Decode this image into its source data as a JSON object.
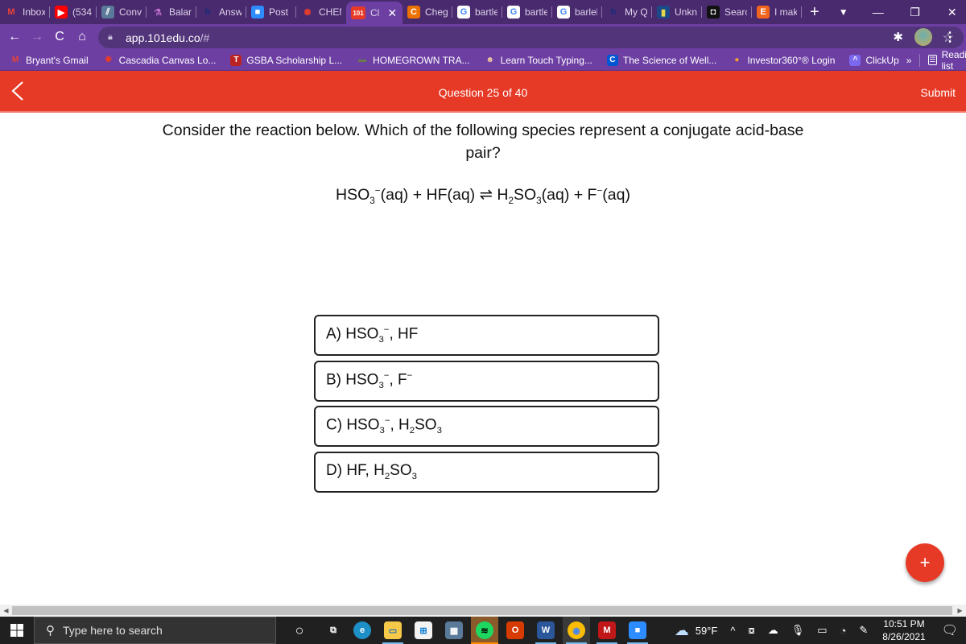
{
  "browser": {
    "tabs": [
      {
        "label": "Inbox",
        "icon": "gmail-icon",
        "glyph": "M",
        "color": "#ea4335",
        "bg": "transparent"
      },
      {
        "label": "(534)",
        "icon": "youtube-icon",
        "glyph": "▶",
        "color": "#fff",
        "bg": "#ff0000"
      },
      {
        "label": "Conv",
        "icon": "convert-icon",
        "glyph": "⫽",
        "color": "#fff",
        "bg": "#5a7a9a"
      },
      {
        "label": "Balan",
        "icon": "flask-icon",
        "glyph": "⚗",
        "color": "#c070d0",
        "bg": "transparent"
      },
      {
        "label": "Answ",
        "icon": "bartleby-icon",
        "glyph": "b",
        "color": "#1a2a7a",
        "bg": "transparent"
      },
      {
        "label": "Post",
        "icon": "zoom-icon",
        "glyph": "■",
        "color": "#fff",
        "bg": "#2d8cff"
      },
      {
        "label": "CHEM",
        "icon": "canvas-icon",
        "glyph": "✺",
        "color": "#e13d2d",
        "bg": "transparent"
      },
      {
        "label": "Cl",
        "icon": "101edu-icon",
        "glyph": "101",
        "color": "#fff",
        "bg": "#e63a26",
        "active": true
      },
      {
        "label": "Cheg",
        "icon": "chegg-icon",
        "glyph": "C",
        "color": "#fff",
        "bg": "#eb7100"
      },
      {
        "label": "bartle",
        "icon": "google-icon",
        "glyph": "G",
        "color": "#4285f4",
        "bg": "#fff"
      },
      {
        "label": "bartle",
        "icon": "google-icon",
        "glyph": "G",
        "color": "#4285f4",
        "bg": "#fff"
      },
      {
        "label": "barlel",
        "icon": "google-icon",
        "glyph": "G",
        "color": "#4285f4",
        "bg": "#fff"
      },
      {
        "label": "My Q",
        "icon": "bartleby-icon",
        "glyph": "b",
        "color": "#1a2a7a",
        "bg": "transparent"
      },
      {
        "label": "Unkn",
        "icon": "unknown-site-icon",
        "glyph": "▮",
        "color": "#e6d84a",
        "bg": "#1a4a8a"
      },
      {
        "label": "Searc",
        "icon": "search-site-icon",
        "glyph": "◘",
        "color": "#fff",
        "bg": "#111"
      },
      {
        "label": "I mak",
        "icon": "etsy-icon",
        "glyph": "E",
        "color": "#fff",
        "bg": "#f1641e"
      }
    ],
    "new_tab": "+",
    "window_controls": {
      "profile": "▼",
      "minimize": "—",
      "restore": "❐",
      "close": "✕"
    },
    "nav": {
      "back": "←",
      "forward": "→",
      "reload": "C",
      "home": "⌂"
    },
    "url_host": "app.101edu.co",
    "url_rest": "/#",
    "bookmarks": [
      {
        "label": "Bryant's Gmail",
        "icon": "gmail-icon",
        "glyph": "M",
        "color": "#ea4335",
        "bg": "transparent"
      },
      {
        "label": "Cascadia Canvas Lo...",
        "icon": "canvas-icon",
        "glyph": "✺",
        "color": "#e13d2d",
        "bg": "transparent"
      },
      {
        "label": "GSBA Scholarship L...",
        "icon": "gsba-icon",
        "glyph": "T",
        "color": "#fff",
        "bg": "#b22"
      },
      {
        "label": "HOMEGROWN TRA...",
        "icon": "homegrown-icon",
        "glyph": "▬",
        "color": "#6a7a4a",
        "bg": "transparent"
      },
      {
        "label": "Learn Touch Typing...",
        "icon": "typing-icon",
        "glyph": "☻",
        "color": "#f0c8a0",
        "bg": "transparent"
      },
      {
        "label": "The Science of Well...",
        "icon": "coursera-icon",
        "glyph": "C",
        "color": "#fff",
        "bg": "#0056d2"
      },
      {
        "label": "Investor360°® Login",
        "icon": "investor360-icon",
        "glyph": "●",
        "color": "#f0a030",
        "bg": "transparent"
      },
      {
        "label": "ClickUp",
        "icon": "clickup-icon",
        "glyph": "^",
        "color": "#fff",
        "bg": "#7b68ee"
      }
    ],
    "bookmarks_overflow": "»",
    "reading_list": "Reading list"
  },
  "app": {
    "header": {
      "question_counter": "Question 25 of 40",
      "submit_label": "Submit"
    },
    "question": {
      "text": "Consider the reaction below. Which of the following species represent a conjugate acid-base pair?",
      "equation_html": "HSO<sub>3</sub><sup>−</sup>(aq) + HF(aq) ⇌ H<sub>2</sub>SO<sub>3</sub>(aq) + F<sup>−</sup>(aq)"
    },
    "options": [
      {
        "letter": "A",
        "html": "A) HSO<sub>3</sub><sup>−</sup>, HF"
      },
      {
        "letter": "B",
        "html": "B) HSO<sub>3</sub><sup>−</sup>, F<sup>−</sup>"
      },
      {
        "letter": "C",
        "html": "C) HSO<sub>3</sub><sup>−</sup>, H<sub>2</sub>SO<sub>3</sub>"
      },
      {
        "letter": "D",
        "html": "D) HF, H<sub>2</sub>SO<sub>3</sub>"
      }
    ],
    "fab_label": "+"
  },
  "taskbar": {
    "search_placeholder": "Type here to search",
    "apps": [
      {
        "name": "cortana-icon",
        "glyph": "○",
        "color": "#fff",
        "bg": "transparent"
      },
      {
        "name": "task-view-icon",
        "glyph": "⧉",
        "color": "#fff",
        "bg": "transparent"
      },
      {
        "name": "edge-icon",
        "glyph": "e",
        "color": "#fff",
        "bg": "#1e90c8",
        "run": false
      },
      {
        "name": "file-explorer-icon",
        "glyph": "▭",
        "color": "#1e6fb8",
        "bg": "#f7c948",
        "run": true
      },
      {
        "name": "store-icon",
        "glyph": "⊞",
        "color": "#0078d4",
        "bg": "#f2f2f2",
        "run": false
      },
      {
        "name": "calculator-icon",
        "glyph": "▦",
        "color": "#fff",
        "bg": "#5a7a9a",
        "run": false
      },
      {
        "name": "spotify-icon",
        "glyph": "≋",
        "color": "#000",
        "bg": "#1ed760",
        "spot": true
      },
      {
        "name": "office-icon",
        "glyph": "O",
        "color": "#fff",
        "bg": "#d83b01",
        "run": false
      },
      {
        "name": "word-icon",
        "glyph": "W",
        "color": "#fff",
        "bg": "#2b579a",
        "run": true
      },
      {
        "name": "chrome-icon",
        "glyph": "◉",
        "color": "#4285f4",
        "bg": "#fbbc05",
        "chrome": true,
        "run": true
      },
      {
        "name": "mcafee-icon",
        "glyph": "M",
        "color": "#fff",
        "bg": "#c01818",
        "run": true
      },
      {
        "name": "zoom-icon",
        "glyph": "■",
        "color": "#fff",
        "bg": "#2d8cff",
        "run": true
      }
    ],
    "weather": "59°F",
    "clock_time": "10:51 PM",
    "clock_date": "8/26/2021"
  }
}
